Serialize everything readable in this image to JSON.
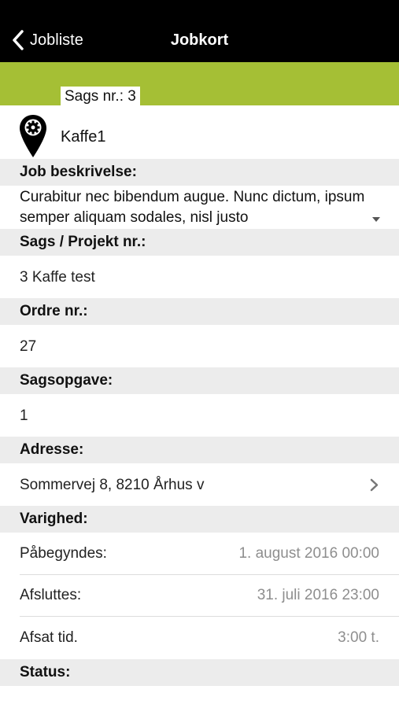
{
  "nav": {
    "back_label": "Jobliste",
    "title": "Jobkort"
  },
  "case": {
    "tag": "Sags nr.: 3",
    "job_name": "Kaffe1"
  },
  "sections": {
    "job_description": {
      "header": "Job beskrivelse:",
      "text": "Curabitur nec bibendum augue. Nunc dictum, ipsum semper aliquam sodales, nisl justo"
    },
    "project": {
      "header": "Sags / Projekt nr.:",
      "value": "3 Kaffe test"
    },
    "order": {
      "header": "Ordre nr.:",
      "value": "27"
    },
    "task": {
      "header": "Sagsopgave:",
      "value": "1"
    },
    "address": {
      "header": "Adresse:",
      "value": "Sommervej 8, 8210 Århus v"
    },
    "duration": {
      "header": "Varighed:",
      "rows": [
        {
          "label": "Påbegyndes:",
          "value": "1. august 2016 00:00"
        },
        {
          "label": "Afsluttes:",
          "value": "31. juli 2016 23:00"
        },
        {
          "label": "Afsat tid.",
          "value": "3:00 t."
        }
      ]
    },
    "status": {
      "header": "Status:"
    }
  },
  "colors": {
    "navbar": "#000000",
    "accent_green": "#a5bf35",
    "section_bg": "#ececec",
    "secondary_text": "#8e8e8e"
  },
  "icons": {
    "back": "chevron-left-icon",
    "location": "location-pin-gear-icon",
    "dropdown": "caret-down-icon",
    "disclosure": "chevron-right-icon"
  }
}
